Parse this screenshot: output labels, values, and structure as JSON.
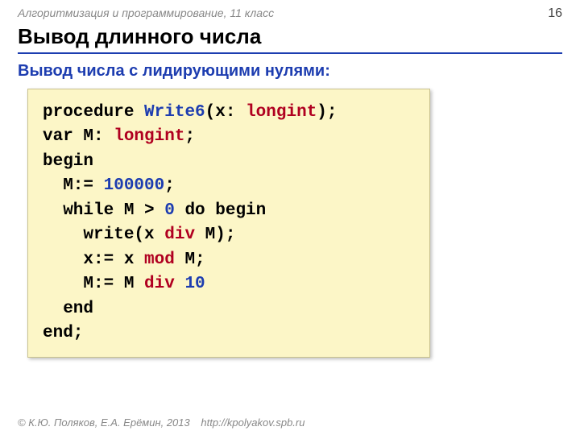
{
  "header": {
    "course": "Алгоритмизация и программирование, 11 класс",
    "page": "16"
  },
  "title": "Вывод длинного числа",
  "subtitle": "Вывод числа с лидирующими нулями:",
  "code": {
    "l1a": "procedure ",
    "l1b": "Write6",
    "l1c": "(x: ",
    "l1d": "longint",
    "l1e": ");",
    "l2a": "var M: ",
    "l2b": "longint",
    "l2c": ";",
    "l3": "begin",
    "l4a": "  M:= ",
    "l4b": "100000",
    "l4c": ";",
    "l5a": "  while M",
    "l5b": " > ",
    "l5c": "0",
    "l5d": " do begin",
    "l6": "    write(x ",
    "l6b": "div",
    "l6c": " M);",
    "l7": "    x:= x ",
    "l7b": "mod",
    "l7c": " M;",
    "l8": "    M:= M ",
    "l8b": "div",
    "l8c": " ",
    "l8d": "10",
    "l9": "  end",
    "l10": "end;"
  },
  "footer": {
    "copyright": "© К.Ю. Поляков, Е.А. Ерёмин, 2013",
    "url": "http://kpolyakov.spb.ru"
  }
}
